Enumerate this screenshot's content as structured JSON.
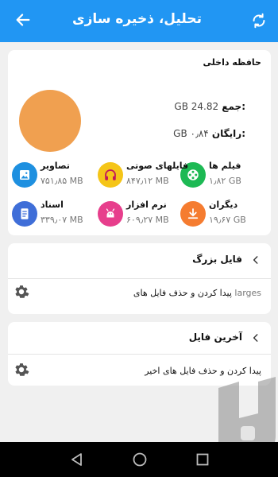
{
  "header": {
    "title": "تحلیل، ذخیره سازی",
    "back_icon": "arrow-left-icon",
    "refresh_icon": "refresh-icon",
    "color": "#2196f3"
  },
  "storage": {
    "section_title": "حافظه داخلی",
    "total_label": "جمع:",
    "total_value": "GB 24.82",
    "free_label": "رایگان:",
    "free_value": "GB ۰٫۸۴",
    "disk_color": "#f0a050"
  },
  "categories": [
    {
      "name": "فیلم ها",
      "size": "۱٫۸۲ GB",
      "icon": "film-reel-icon",
      "color": "#1db954"
    },
    {
      "name": "فایلهای صوتی",
      "size": "۸۴۷٫۱۲ MB",
      "icon": "headphones-icon",
      "color": "#f5c518"
    },
    {
      "name": "تصاویر",
      "size": "۷۵۱٫۸۵ MB",
      "icon": "image-icon",
      "color": "#1e90e0"
    },
    {
      "name": "دیگران",
      "size": "۱۹٫۶۷ GB",
      "icon": "download-icon",
      "color": "#f57c30"
    },
    {
      "name": "نرم افزار",
      "size": "۶۰۹٫۲۷ MB",
      "icon": "apps-icon",
      "color": "#e73e8c"
    },
    {
      "name": "اسناد",
      "size": "۳۳۹٫۰۷ MB",
      "icon": "document-icon",
      "color": "#3f6ed8"
    }
  ],
  "large_files": {
    "title": "فایل بزرگ",
    "subtitle": "پیدا کردن و حذف فایل های",
    "tag": "larges"
  },
  "recent_files": {
    "title": "آخرین فایل",
    "subtitle": "پیدا کردن و حذف فایل های اخیر"
  },
  "navbar": {
    "back": "nav-back-icon",
    "home": "nav-home-icon",
    "recents": "nav-recents-icon"
  }
}
